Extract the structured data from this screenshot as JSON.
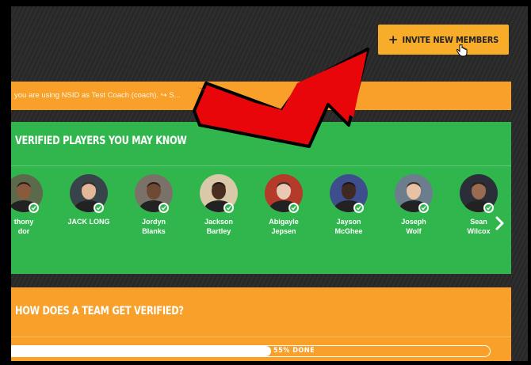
{
  "header": {
    "invite_label": "INVITE NEW MEMBERS"
  },
  "notice": {
    "text": "you are using NSID as Test Coach (coach). ↪ S..."
  },
  "verified": {
    "title": "VERIFIED PLAYERS YOU MAY KNOW",
    "players": [
      {
        "first": "thony",
        "last": "dor",
        "skin": "#8a5a3c",
        "bg": "#5b6a4a"
      },
      {
        "first": "JACK LONG",
        "last": "",
        "skin": "#e2b79a",
        "bg": "#39434a"
      },
      {
        "first": "Jordyn",
        "last": "Blanks",
        "skin": "#6e4a35",
        "bg": "#7a7268"
      },
      {
        "first": "Jackson",
        "last": "Bartley",
        "skin": "#4a2e21",
        "bg": "#d9c9a8"
      },
      {
        "first": "Abigayle",
        "last": "Jepsen",
        "skin": "#e9c8b4",
        "bg": "#b43a2a"
      },
      {
        "first": "Jayson",
        "last": "McGhee",
        "skin": "#3f2a22",
        "bg": "#3e4d8c"
      },
      {
        "first": "Joseph",
        "last": "Wolf",
        "skin": "#e8c2a2",
        "bg": "#6c7d8e"
      },
      {
        "first": "Sean",
        "last": "Wilcox",
        "skin": "#9a6b4e",
        "bg": "#2b2e38"
      }
    ]
  },
  "howdoes": {
    "title": "HOW DOES A TEAM GET VERIFIED?",
    "progress_percent": 55,
    "progress_label": "55% DONE"
  },
  "colors": {
    "accent_orange": "#f8ad2a",
    "green": "#31b64d",
    "arrow_red": "#e8060a"
  }
}
